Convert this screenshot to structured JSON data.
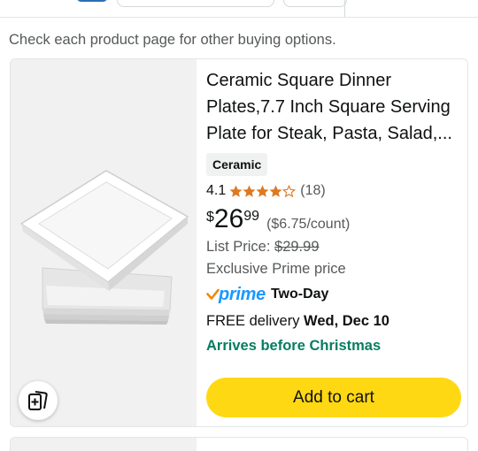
{
  "notice": "Check each product page for other buying options.",
  "product": {
    "title": "Ceramic Square Dinner Plates,7.7 Inch Square Serving Plate for Steak, Pasta, Salad,...",
    "badge": "Ceramic",
    "rating": "4.1",
    "rating_value": 4.1,
    "rating_max": 5,
    "review_count": "(18)",
    "price": {
      "symbol": "$",
      "whole": "26",
      "fraction": "99",
      "unit_price": "($6.75/count)"
    },
    "list_price_label": "List Price:",
    "list_price": "$29.99",
    "exclusive": "Exclusive Prime price",
    "prime_label": "prime",
    "prime_speed": "Two-Day",
    "delivery_prefix": "FREE delivery",
    "delivery_date": "Wed, Dec 10",
    "arrives": "Arrives before Christmas",
    "add_to_cart": "Add to cart",
    "image_icon": "square-plates-image",
    "compare_icon": "compare-add-icon"
  },
  "colors": {
    "star": "#de7921",
    "prime": "#1a98ff",
    "checkmark": "#f08804",
    "arrives": "#067d62",
    "cart_button": "#ffd814"
  }
}
